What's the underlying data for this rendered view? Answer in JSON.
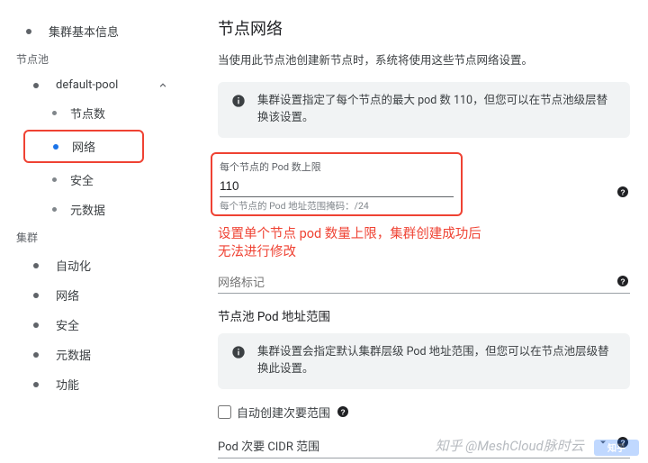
{
  "sidebar": {
    "items": [
      {
        "label": "集群基本信息"
      }
    ],
    "pool_header": "节点池",
    "pool_name": "default-pool",
    "pool_items": [
      {
        "label": "节点数"
      },
      {
        "label": "网络",
        "active": true
      },
      {
        "label": "安全"
      },
      {
        "label": "元数据"
      }
    ],
    "cluster_header": "集群",
    "cluster_items": [
      {
        "label": "自动化"
      },
      {
        "label": "网络"
      },
      {
        "label": "安全"
      },
      {
        "label": "元数据"
      },
      {
        "label": "功能"
      }
    ]
  },
  "main": {
    "title": "节点网络",
    "description": "当使用此节点池创建新节点时，系统将使用这些节点网络设置。",
    "notice1": "集群设置指定了每个节点的最大 pod 数 110，但您可以在节点池级层替换该设置。",
    "pod_limit_label": "每个节点的 Pod 数上限",
    "pod_limit_value": "110",
    "pod_limit_help": "每个节点的 Pod 地址范围掩码：/24",
    "annotation": "设置单个节点 pod 数量上限，集群创建成功后\n无法进行修改",
    "net_tag_placeholder": "网络标记",
    "addr_range_title": "节点池 Pod 地址范围",
    "notice2": "集群设置会指定默认集群层级 Pod 地址范围，但您可以在节点池层级替换此设置。",
    "auto_create_label": "自动创建次要范围",
    "cidr_select_label": "Pod 次要 CIDR 范围"
  },
  "watermark": "知乎 @MeshCloud脉时云"
}
